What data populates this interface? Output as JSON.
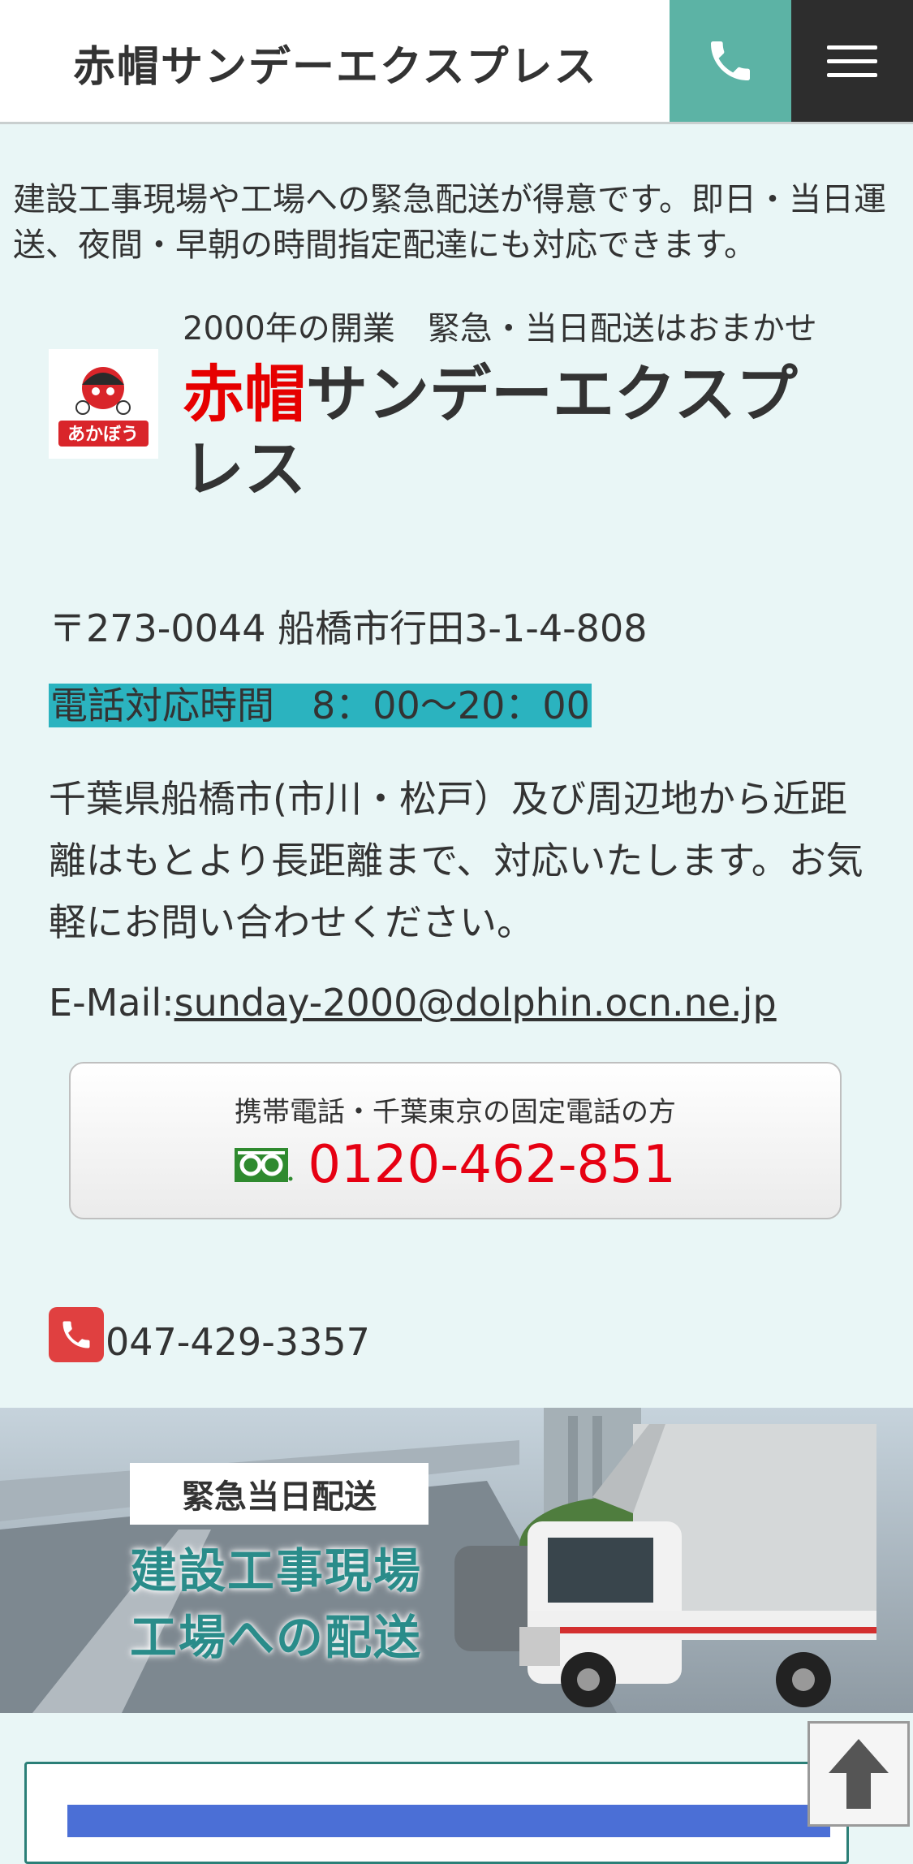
{
  "header": {
    "title": "赤帽サンデーエクスプレス",
    "phone_icon": "phone-icon",
    "menu_icon": "hamburger-menu-icon"
  },
  "intro": "建設工事現場や工場への緊急配送が得意です。即日・当日運送、夜間・早朝の時間指定配達にも対応できます。",
  "company": {
    "tagline": "2000年の開業　緊急・当日配送はおまかせ",
    "brand_red": "赤帽",
    "brand_rest": "サンデーエクスプレス",
    "logo_text": "あかぼう",
    "address": "〒273-0044 船橋市行田3-1-4-808",
    "hours": "電話対応時間　8：00〜20：00",
    "description": "千葉県船橋市(市川・松戸）及び周辺地から近距離はもとより長距離まで、対応いたします。お気軽にお問い合わせください。",
    "email_label": "E-Mail:",
    "email": "sunday-2000@dolphin.ocn.ne.jp"
  },
  "callbox": {
    "lead": "携帯電話・千葉東京の固定電話の方",
    "icon": "freedial-icon",
    "number": "0120-462-851"
  },
  "tel": {
    "icon": "phone-icon",
    "number": "047-429-3357"
  },
  "banner": {
    "badge": "緊急当日配送",
    "line1": "建設工事現場",
    "line2": "工場への配送"
  },
  "scroll_top_icon": "arrow-up-icon",
  "colors": {
    "accent_teal": "#5cb3a5",
    "menu_dark": "#2d2d2d",
    "brand_red": "#e60000",
    "hours_highlight": "#2bb3bf",
    "background": "#e9f6f6"
  }
}
